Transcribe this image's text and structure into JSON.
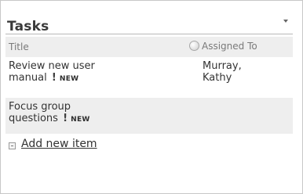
{
  "webpart": {
    "title": "Tasks",
    "columns": {
      "title": "Title",
      "assigned_to": "Assigned To"
    },
    "rows": [
      {
        "title_line1": "Review new user",
        "title_line2": "manual",
        "assigned_line1": "Murray,",
        "assigned_line2": "Kathy",
        "badge": "NEW",
        "mark": "!"
      },
      {
        "title_line1": "Focus group",
        "title_line2": "questions",
        "assigned_line1": "",
        "assigned_line2": "",
        "badge": "NEW",
        "mark": "!"
      }
    ],
    "add_new_label": "Add new item"
  }
}
